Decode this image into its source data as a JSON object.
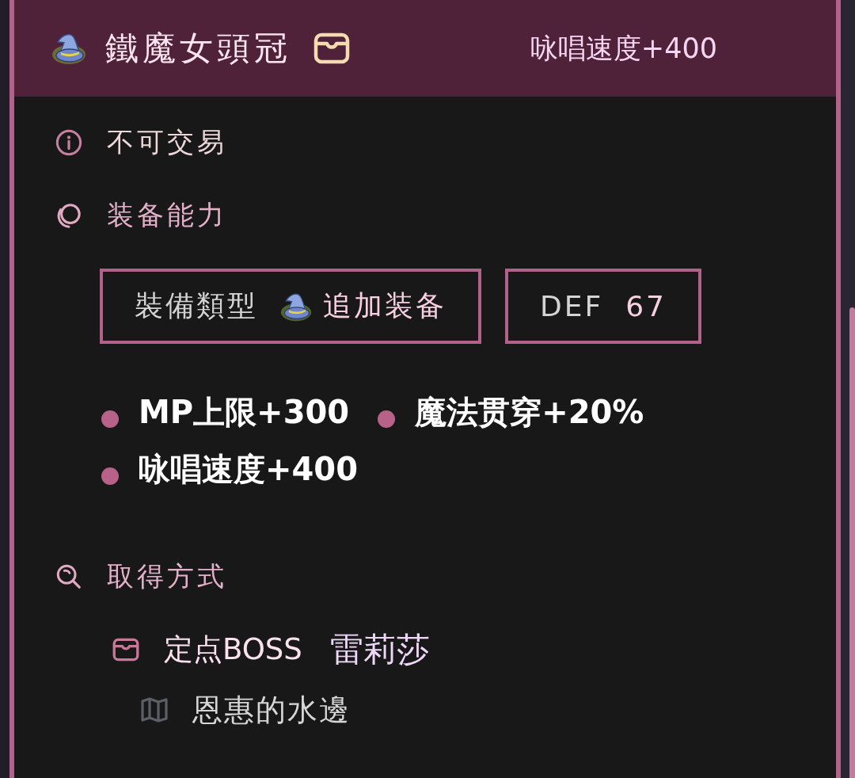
{
  "header": {
    "title": "鐵魔女頭冠",
    "highlight": "咏唱速度+400"
  },
  "sections": [
    {
      "kind": "note",
      "label": "不可交易"
    },
    {
      "kind": "abilities",
      "label": "装备能力",
      "tags": [
        {
          "kind": "type",
          "label": "裝備類型",
          "value": "追加装备"
        },
        {
          "kind": "stat",
          "label": "DEF",
          "value": "67"
        }
      ],
      "bonuses": [
        "MP上限+300",
        "魔法贯穿+20%",
        "咏唱速度+400"
      ]
    },
    {
      "kind": "sources",
      "label": "取得方式",
      "sources": [
        {
          "kind": "boss",
          "label": "定点BOSS",
          "name": "雷莉莎",
          "location": "恩惠的水邊"
        }
      ]
    }
  ]
}
